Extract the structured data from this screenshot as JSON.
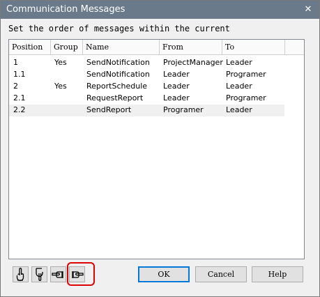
{
  "window": {
    "title": "Communication Messages",
    "close_label": "✕"
  },
  "instruction": "Set the order of messages within the current",
  "columns": [
    "Position",
    "Group",
    "Name",
    "From",
    "To"
  ],
  "rows": [
    {
      "position": "1",
      "group": "Yes",
      "name": "SendNotification",
      "from": "ProjectManager",
      "to": "Leader"
    },
    {
      "position": "1.1",
      "group": "",
      "name": "SendNotification",
      "from": "Leader",
      "to": "Programer"
    },
    {
      "position": "2",
      "group": "Yes",
      "name": "ReportSchedule",
      "from": "Leader",
      "to": "Leader"
    },
    {
      "position": "2.1",
      "group": "",
      "name": "RequestReport",
      "from": "Leader",
      "to": "Programer"
    },
    {
      "position": "2.2",
      "group": "",
      "name": "SendReport",
      "from": "Programer",
      "to": "Leader"
    }
  ],
  "selected_row": "2.2",
  "toolbar": {
    "icons": [
      "hand-point-up-icon",
      "hand-point-down-icon",
      "hand-point-left-icon",
      "hand-point-right-icon"
    ]
  },
  "buttons": {
    "ok": "OK",
    "cancel": "Cancel",
    "help": "Help"
  },
  "colors": {
    "title_bar": "#6b7a8b",
    "highlight": "#e00000",
    "default_button_border": "#0078d7"
  }
}
